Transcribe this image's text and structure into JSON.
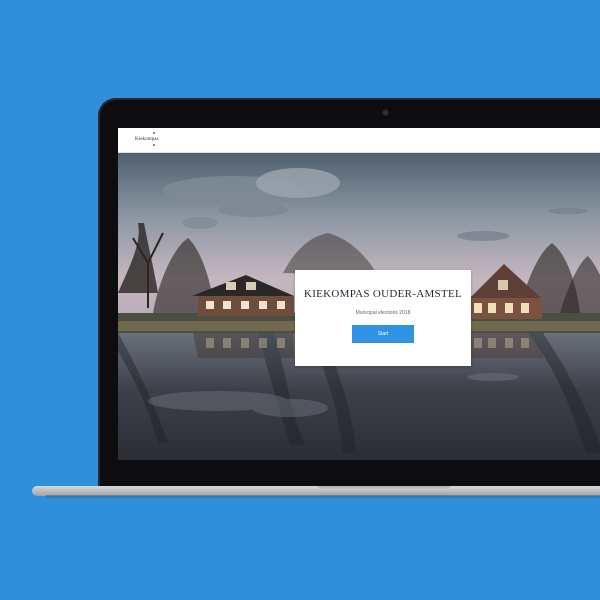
{
  "app": {
    "background_color": "#2f8fdb",
    "accent_color": "#2f92e2"
  },
  "site_header": {
    "logo_text": "Kiekompas",
    "menu_icon": "hamburger-menu-icon"
  },
  "hero_card": {
    "title": "KIEKOMPAS OUDER-AMSTEL",
    "subtitle": "Municipal elections 2018",
    "start_label": "Start"
  }
}
